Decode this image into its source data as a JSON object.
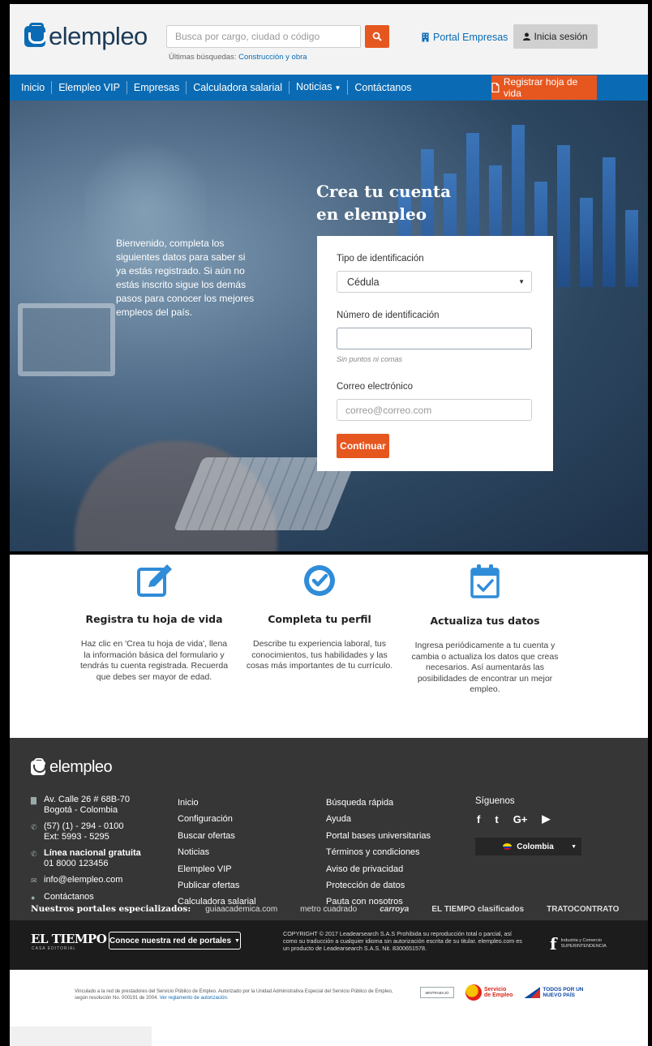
{
  "header": {
    "logo_text": "elempleo",
    "search_placeholder": "Busca por cargo, ciudad o código",
    "recent_label": "Últimas búsquedas:",
    "recent_link": "Construcción y obra",
    "portal_link": "Portal Empresas",
    "login_label": "Inicia sesión"
  },
  "nav": {
    "items": [
      "Inicio",
      "Elempleo VIP",
      "Empresas",
      "Calculadora salarial",
      "Noticias",
      "Contáctanos"
    ],
    "register_label": "Registrar hoja de vida"
  },
  "hero": {
    "welcome_text": "Bienvenido, completa los siguientes datos para saber si ya estás registrado. Si aún no estás inscrito sigue los demás pasos para conocer los mejores empleos del país.",
    "title": "Crea tu cuenta en elempleo"
  },
  "form": {
    "id_type_label": "Tipo de identificación",
    "id_type_value": "Cédula",
    "id_number_label": "Número de identificación",
    "id_number_value": "",
    "id_hint": "Sin puntos ni comas",
    "email_label": "Correo electrónico",
    "email_placeholder": "correo@correo.com",
    "submit_label": "Continuar"
  },
  "features": [
    {
      "title": "Registra tu hoja de vida",
      "desc": "Haz clic en 'Crea tu hoja de vida', llena la información básica del formulario y tendrás tu cuenta registrada. Recuerda que debes ser mayor de edad.",
      "icon": "edit-icon"
    },
    {
      "title": "Completa tu perfil",
      "desc": "Describe tu experiencia laboral, tus conocimientos, tus habilidades y las cosas más importantes de tu currículo.",
      "icon": "check-circle-icon"
    },
    {
      "title": "Actualiza tus datos",
      "desc": "Ingresa periódicamente a tu cuenta y cambia o actualiza los datos que creas necesarios. Así aumentarás las posibilidades de encontrar un mejor empleo.",
      "icon": "calendar-check-icon"
    }
  ],
  "footer": {
    "logo_text": "elempleo",
    "address_1": "Av. Calle 26 # 68B-70",
    "address_2": "Bogotá - Colombia",
    "phone_1": "(57) (1) - 294 - 0100",
    "phone_2": "Ext: 5993 - 5295",
    "national_line_label": "Línea nacional gratuita",
    "national_line_number": "01 8000 123456",
    "email": "info@elempleo.com",
    "contact": "Contáctanos",
    "col2": [
      "Inicio",
      "Configuración",
      "Buscar ofertas",
      "Noticias",
      "Elempleo VIP",
      "Publicar ofertas",
      "Calculadora salarial"
    ],
    "col3": [
      "Búsqueda rápida",
      "Ayuda",
      "Portal bases universitarias",
      "Términos y condiciones",
      "Aviso de privacidad",
      "Protección de datos",
      "Pauta con nosotros"
    ],
    "social_title": "Síguenos",
    "social": [
      "f",
      "t",
      "G+",
      "▶"
    ],
    "country": "Colombia",
    "portals_label": "Nuestros portales especializados:",
    "portals": [
      "guiaacademica.com",
      "metro cuadrado",
      "carroya",
      "EL TIEMPO clasificados",
      "TRATOCONTRATO"
    ]
  },
  "bottom": {
    "eltiempo": "EL TIEMPO",
    "eltiempo_sub": "CASA EDITORIAL",
    "network_label": "Conoce nuestra red de portales",
    "copyright": "COPYRIGHT © 2017 Leadearsearch S.A.S Prohibida su reproducción total o parcial, así como su traducción a cualquier idioma sin autorización escrita de su titular. elempleo.com es un producto de Leadearsearch S.A.S. Nit. 8300651578.",
    "sic_title": "Industria y Comercio",
    "sic_sub": "SUPERINTENDENCIA"
  },
  "legal": {
    "text": "Vinculado a la red de prestadores del Servicio Público de Empleo. Autorizado por la Unidad Administrativa Especial del Servicio Público de Empleo, según resolución No. 000191 de 2004.",
    "link": "Ver reglamento de autorización.",
    "mintrabajo": "MINTRABAJO",
    "servicio_1": "Servicio",
    "servicio_2": "de Empleo",
    "todos_1": "TODOS POR UN",
    "todos_2": "NUEVO PAÍS"
  },
  "colors": {
    "brand_blue": "#0a6bb4",
    "accent_orange": "#e6561f",
    "footer_bg": "#363636"
  }
}
